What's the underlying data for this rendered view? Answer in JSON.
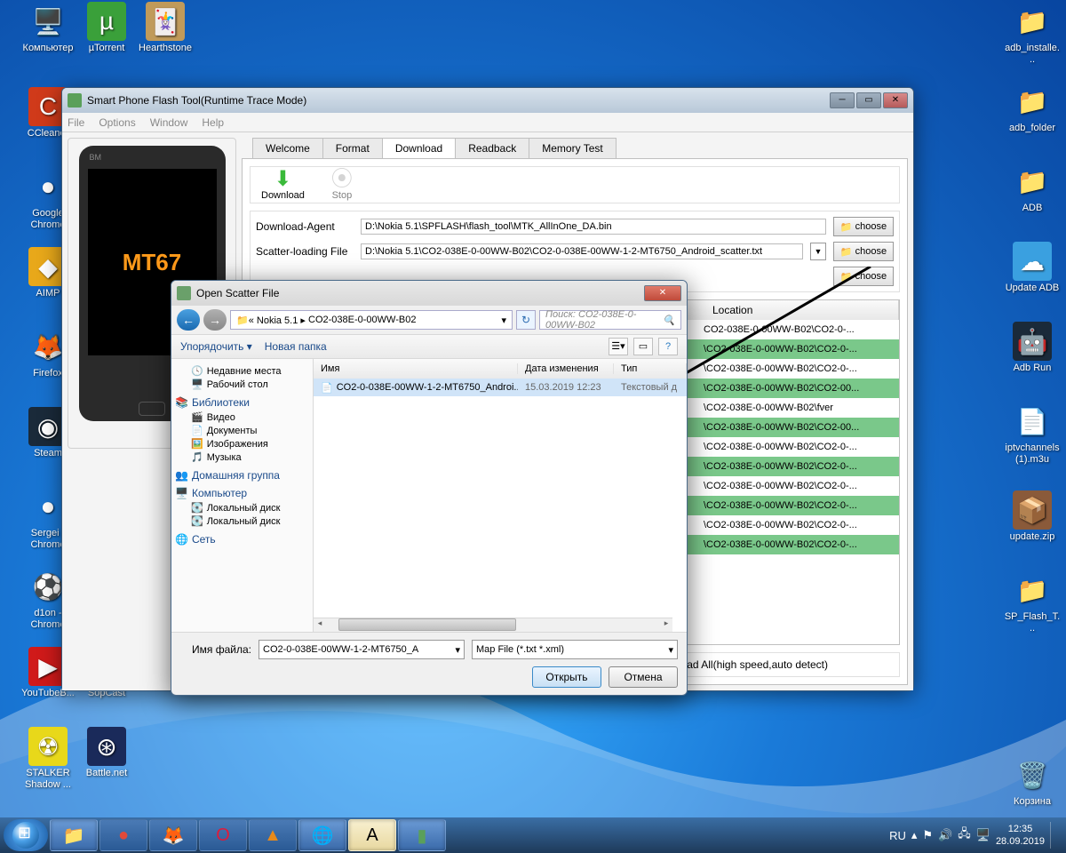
{
  "desktop_icons_left": [
    {
      "label": "Компьютер",
      "glyph": "🖥️",
      "bg": ""
    },
    {
      "label": "µTorrent",
      "glyph": "µ",
      "bg": "#3aa03a"
    },
    {
      "label": "Hearthstone",
      "glyph": "🃏",
      "bg": "#c09a5a"
    },
    {
      "label": "CCleaner",
      "glyph": "C",
      "bg": "#d03a1a"
    },
    {
      "label": "Google Chrome",
      "glyph": "●",
      "bg": ""
    },
    {
      "label": "AIMP",
      "glyph": "◆",
      "bg": "#e8a81a"
    },
    {
      "label": "Firefox",
      "glyph": "🦊",
      "bg": ""
    },
    {
      "label": "Steam",
      "glyph": "◉",
      "bg": "#1a2a3a"
    },
    {
      "label": "Sergei - Chrome",
      "glyph": "●",
      "bg": ""
    },
    {
      "label": "d1on - Chrome",
      "glyph": "⚽",
      "bg": ""
    },
    {
      "label": "YouTubeB...",
      "glyph": "▶",
      "bg": "#d01a1a"
    },
    {
      "label": "SopCast",
      "glyph": "📡",
      "bg": ""
    },
    {
      "label": "STALKER Shadow ...",
      "glyph": "☢",
      "bg": "#e8d81a"
    },
    {
      "label": "Battle.net",
      "glyph": "⊛",
      "bg": "#1a2a5a"
    }
  ],
  "desktop_icons_right": [
    {
      "label": "adb_installe...",
      "glyph": "📁"
    },
    {
      "label": "adb_folder",
      "glyph": "📁"
    },
    {
      "label": "ADB",
      "glyph": "📁"
    },
    {
      "label": "Update ADB",
      "glyph": "☁",
      "bg": "#3aa0e0"
    },
    {
      "label": "Adb Run",
      "glyph": "🤖",
      "bg": "#1a2a3a"
    },
    {
      "label": "iptvchannels (1).m3u",
      "glyph": "📄"
    },
    {
      "label": "update.zip",
      "glyph": "📦",
      "bg": "#8a5a3a"
    },
    {
      "label": "SP_Flash_T...",
      "glyph": "📁"
    },
    {
      "label": "Корзина",
      "glyph": "🗑️"
    }
  ],
  "sp": {
    "title": "Smart Phone Flash Tool(Runtime Trace Mode)",
    "menu": [
      "File",
      "Options",
      "Window",
      "Help"
    ],
    "tabs": [
      "Welcome",
      "Format",
      "Download",
      "Readback",
      "Memory Test"
    ],
    "active_tab": "Download",
    "tools": {
      "download": "Download",
      "stop": "Stop"
    },
    "phone_text": "MT67",
    "fields": {
      "da_label": "Download-Agent",
      "da_value": "D:\\Nokia 5.1\\SPFLASH\\flash_tool\\MTK_AllInOne_DA.bin",
      "scatter_label": "Scatter-loading File",
      "scatter_value": "D:\\Nokia 5.1\\CO2-038E-0-00WW-B02\\CO2-0-038E-00WW-1-2-MT6750_Android_scatter.txt",
      "choose": "choose"
    },
    "table_head": {
      "c2": "Location"
    },
    "rows": [
      {
        "g": false,
        "loc": "CO2-038E-0-00WW-B02\\CO2-0-..."
      },
      {
        "g": true,
        "loc": "\\CO2-038E-0-00WW-B02\\CO2-0-..."
      },
      {
        "g": false,
        "loc": "\\CO2-038E-0-00WW-B02\\CO2-0-..."
      },
      {
        "g": true,
        "loc": "\\CO2-038E-0-00WW-B02\\CO2-00..."
      },
      {
        "g": false,
        "loc": "\\CO2-038E-0-00WW-B02\\fver"
      },
      {
        "g": true,
        "loc": "\\CO2-038E-0-00WW-B02\\CO2-00..."
      },
      {
        "g": false,
        "loc": "\\CO2-038E-0-00WW-B02\\CO2-0-..."
      },
      {
        "g": true,
        "loc": "\\CO2-038E-0-00WW-B02\\CO2-0-..."
      },
      {
        "g": false,
        "loc": "\\CO2-038E-0-00WW-B02\\CO2-0-..."
      },
      {
        "g": true,
        "loc": "\\CO2-038E-0-00WW-B02\\CO2-0-..."
      },
      {
        "g": false,
        "loc": "\\CO2-038E-0-00WW-B02\\CO2-0-..."
      },
      {
        "g": true,
        "loc": "\\CO2-038E-0-00WW-B02\\CO2-0-..."
      }
    ],
    "status": "Download All(high speed,auto detect)"
  },
  "dlg": {
    "title": "Open Scatter File",
    "crumb_prefix": "« Nokia 5.1 ▸",
    "crumb": "CO2-038E-0-00WW-B02",
    "search_placeholder": "Поиск: CO2-038E-0-00WW-B02",
    "toolbar": {
      "organize": "Упорядочить ▾",
      "newfolder": "Новая папка"
    },
    "side": {
      "recent": "Недавние места",
      "desktop": "Рабочий стол",
      "libs": "Библиотеки",
      "video": "Видео",
      "docs": "Документы",
      "pics": "Изображения",
      "music": "Музыка",
      "home": "Домашняя группа",
      "computer": "Компьютер",
      "disk1": "Локальный диск",
      "disk2": "Локальный диск",
      "net": "Сеть"
    },
    "list_head": {
      "name": "Имя",
      "date": "Дата изменения",
      "type": "Тип"
    },
    "file": {
      "name": "CO2-0-038E-00WW-1-2-MT6750_Androi...",
      "date": "15.03.2019 12:23",
      "type": "Текстовый д"
    },
    "filename_label": "Имя файла:",
    "filename_value": "CO2-0-038E-00WW-1-2-MT6750_A",
    "filetype": "Map File (*.txt *.xml)",
    "open": "Открыть",
    "cancel": "Отмена"
  },
  "taskbar": {
    "lang": "RU",
    "time": "12:35",
    "date": "28.09.2019"
  }
}
